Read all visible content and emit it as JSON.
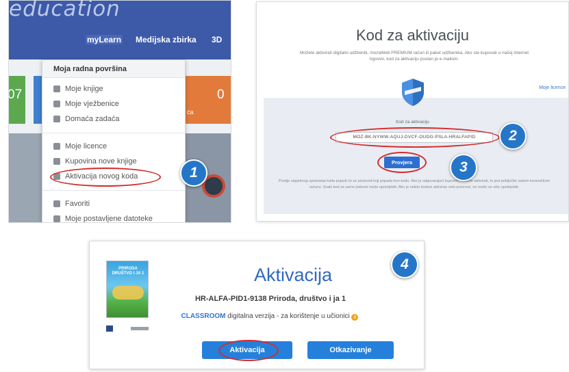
{
  "panel1": {
    "brand": "education",
    "nav": [
      "myLearn",
      "Medijska zbirka",
      "3D"
    ],
    "tiles": {
      "left_value": "07",
      "right_value": "0",
      "right_caption": "ća"
    },
    "dropdown": {
      "header": "Moja radna površina",
      "group1": [
        "Moje knjige",
        "Moje vježbenice",
        "Domaća zadaća"
      ],
      "group2": [
        "Moje licence",
        "Kupovina nove knjige",
        "Aktivacija novog koda"
      ],
      "group3": [
        "Favoriti",
        "Moje postavljene datoteke"
      ]
    },
    "badge": "1"
  },
  "panel2": {
    "title": "Kod za aktivaciju",
    "description": "Možete aktivirati digitalni udžbenik, mozaWeb PREMIUM račun ili paket udžbenika. Ako ste kupovali u našoj internet trgovini, kod za aktivaciju poslan je e-mailom.",
    "licences_link": "Moje licence",
    "field_label": "Kod za aktivaciju",
    "code_value": "MOZ-BK-NYWW-AQUJ-DVCF-OUDG-PSLA-HRALFAPID",
    "check_button": "Provjera",
    "note": "Poslije uspješnog upisivanja koda pojavit će se proizvod koji pripada tom kodu. Ako je odgovarajući kupovini, možete aktivirati, te jest priključite vašem korisničkom računu. Svaki kod se samo jednom može upotrijebiti. Ako je nekim kodom aktiviran neki proizvod, ne može se više upotrijebiti.",
    "badges": [
      "2",
      "3"
    ]
  },
  "panel3": {
    "heading": "Aktivacija",
    "product": "HR-ALFA-PID1-9138 Priroda, društvo i ja 1",
    "edition_highlight": "CLASSROOM",
    "edition_text": "digitalna verzija - za korištenje u učionici",
    "info_icon": "i",
    "book_cover_title": "PRIRODA DRUŠTVO I JA 1",
    "activate_button": "Aktivacija",
    "cancel_button": "Otkazivanje",
    "badge": "4"
  },
  "colors": {
    "nav_blue": "#3d5aa8",
    "accent_blue": "#2580db",
    "highlight_red": "#d52b2b",
    "badge_blue": "#2576c9"
  }
}
